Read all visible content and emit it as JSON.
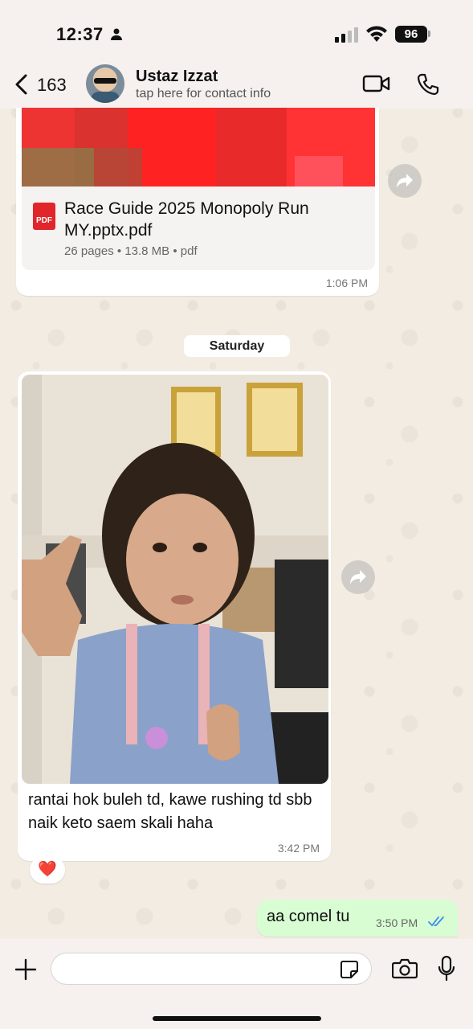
{
  "status_bar": {
    "time": "12:37",
    "battery": "96"
  },
  "header": {
    "back_count": "163",
    "contact_name": "Ustaz Izzat",
    "contact_subtitle": "tap here for contact info"
  },
  "messages": {
    "document": {
      "file_name": "Race Guide 2025 Monopoly Run MY.pptx.pdf",
      "pdf_badge": "PDF",
      "meta": "26 pages • 13.8 MB • pdf",
      "time": "1:06 PM"
    },
    "date_separator": "Saturday",
    "photo_message": {
      "caption": "rantai hok buleh td, kawe rushing td sbb naik keto saem skali haha",
      "time": "3:42 PM",
      "reaction": "❤️"
    },
    "outgoing": {
      "text": "aa comel tu",
      "time": "3:50 PM"
    }
  },
  "input": {
    "placeholder": ""
  },
  "colors": {
    "outgoing_bubble": "#d9fdd3",
    "read_tick": "#3b8cf0",
    "pdf_red": "#e0262b"
  }
}
